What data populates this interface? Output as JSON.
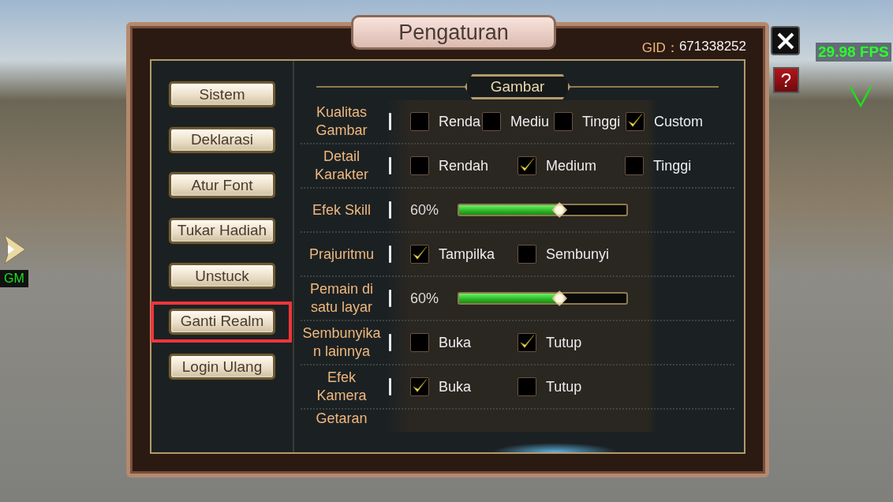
{
  "dialog": {
    "title": "Pengaturan",
    "gid_label": "GID：",
    "gid_value": "671338252",
    "help_button": "?"
  },
  "menu": [
    {
      "label": "Sistem",
      "highlighted": false
    },
    {
      "label": "Deklarasi",
      "highlighted": false
    },
    {
      "label": "Atur Font",
      "highlighted": false
    },
    {
      "label": "Tukar Hadiah",
      "highlighted": false
    },
    {
      "label": "Unstuck",
      "highlighted": false
    },
    {
      "label": "Ganti Realm",
      "highlighted": true
    },
    {
      "label": "Login Ulang",
      "highlighted": false
    }
  ],
  "section": {
    "title": "Gambar"
  },
  "settings": [
    {
      "kind": "options",
      "label": "Kualitas Gambar",
      "options": [
        {
          "label": "Renda",
          "checked": false
        },
        {
          "label": "Mediu",
          "checked": false
        },
        {
          "label": "Tinggi",
          "checked": false
        },
        {
          "label": "Custom",
          "checked": true
        }
      ]
    },
    {
      "kind": "options",
      "label": "Detail Karakter",
      "options": [
        {
          "label": "Rendah",
          "checked": false
        },
        {
          "label": "Medium",
          "checked": true
        },
        {
          "label": "Tinggi",
          "checked": false
        }
      ]
    },
    {
      "kind": "slider",
      "label": "Efek Skill",
      "reading": "60%",
      "level": 0.6
    },
    {
      "kind": "options",
      "label": "Prajuritmu",
      "options": [
        {
          "label": "Tampilka",
          "checked": true
        },
        {
          "label": "Sembunyi",
          "checked": false
        }
      ]
    },
    {
      "kind": "slider",
      "label": "Pemain di satu layar",
      "reading": "60%",
      "level": 0.6
    },
    {
      "kind": "options",
      "label": "Sembunyikan lainnya",
      "options": [
        {
          "label": "Buka",
          "checked": false
        },
        {
          "label": "Tutup",
          "checked": true
        }
      ]
    },
    {
      "kind": "options",
      "label": "Efek Kamera",
      "options": [
        {
          "label": "Buka",
          "checked": true
        },
        {
          "label": "Tutup",
          "checked": false
        }
      ]
    },
    {
      "kind": "options",
      "label": "Getaran"
    }
  ],
  "hud": {
    "fps": "29.98 FPS",
    "gm_label": "GM"
  }
}
